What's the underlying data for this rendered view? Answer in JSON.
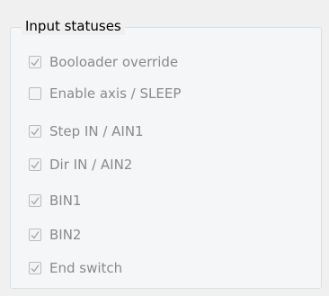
{
  "group": {
    "title": "Input statuses",
    "items": [
      {
        "label": "Booloader override",
        "checked": true
      },
      {
        "label": "Enable axis / SLEEP",
        "checked": false
      },
      {
        "label": "Step IN / AIN1",
        "checked": true
      },
      {
        "label": "Dir IN / AIN2",
        "checked": true
      },
      {
        "label": "BIN1",
        "checked": true
      },
      {
        "label": "BIN2",
        "checked": true
      },
      {
        "label": "End switch",
        "checked": true
      }
    ]
  },
  "colors": {
    "text_disabled": "#8a8a8a",
    "check_mark": "#a8a8a8",
    "box_border": "#bcbcbc",
    "group_border": "#d5dfe5"
  }
}
